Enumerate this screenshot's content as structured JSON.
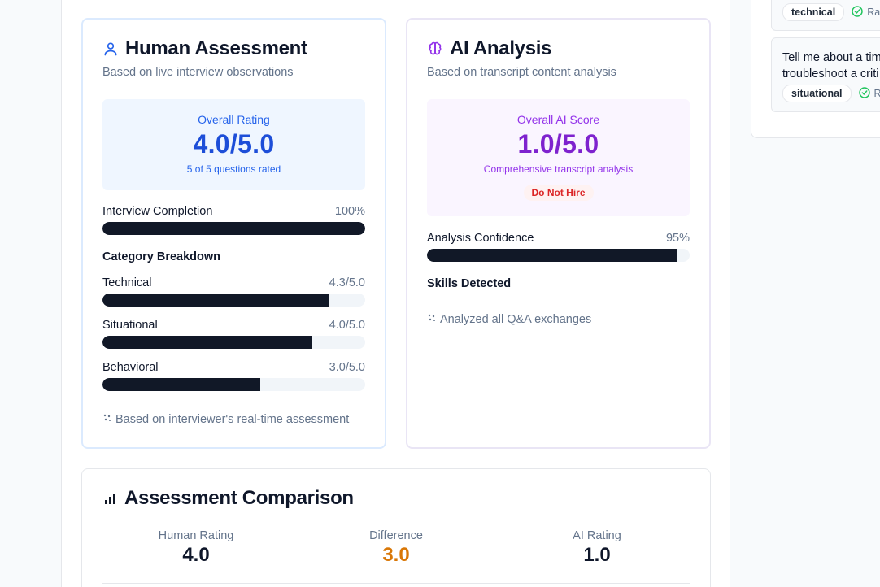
{
  "human": {
    "title": "Human Assessment",
    "subtitle": "Based on live interview observations",
    "overall_label": "Overall Rating",
    "overall_value": "4.0/5.0",
    "overall_note": "5 of 5 questions rated",
    "completion": {
      "label": "Interview Completion",
      "value_text": "100%",
      "fraction": 1.0
    },
    "category_title": "Category Breakdown",
    "categories": [
      {
        "label": "Technical",
        "value_text": "4.3/5.0",
        "score": 4.3
      },
      {
        "label": "Situational",
        "value_text": "4.0/5.0",
        "score": 4.0
      },
      {
        "label": "Behavioral",
        "value_text": "3.0/5.0",
        "score": 3.0
      }
    ],
    "footer": "Based on interviewer's real-time assessment"
  },
  "ai": {
    "title": "AI Analysis",
    "subtitle": "Based on transcript content analysis",
    "overall_label": "Overall AI Score",
    "overall_value": "1.0/5.0",
    "overall_note": "Comprehensive transcript analysis",
    "recommendation": "Do Not Hire",
    "confidence": {
      "label": "Analysis Confidence",
      "value_text": "95%",
      "fraction": 0.95
    },
    "skills_title": "Skills Detected",
    "footer": "Analyzed all Q&A exchanges"
  },
  "comparison": {
    "title": "Assessment Comparison",
    "human_label": "Human Rating",
    "human_value": "4.0",
    "diff_label": "Difference",
    "diff_value": "3.0",
    "ai_label": "AI Rating",
    "ai_value": "1.0"
  },
  "side": {
    "questions": [
      {
        "text": "",
        "tag": "technical",
        "status": "Ra"
      },
      {
        "text_line1": "Tell me about a tim",
        "text_line2": "troubleshoot a criti",
        "tag": "situational",
        "status": "R"
      }
    ]
  },
  "colors": {
    "human_accent": "#2563eb",
    "ai_accent": "#9333ea",
    "bar_fill": "#111827",
    "difference": "#d97706",
    "danger": "#dc2626",
    "success": "#22c55e"
  }
}
